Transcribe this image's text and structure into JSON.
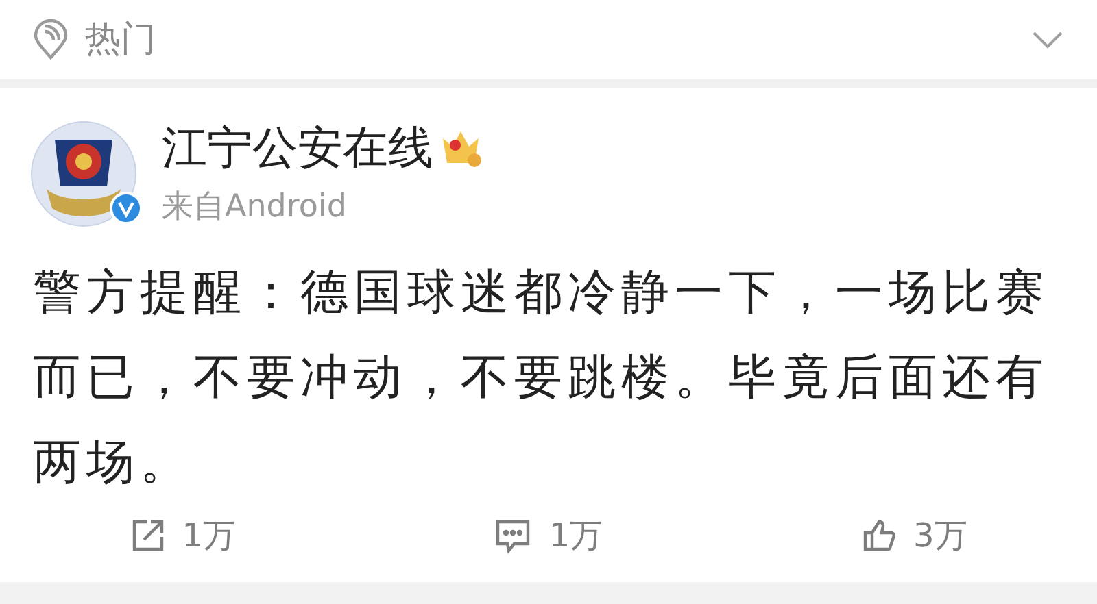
{
  "header": {
    "title": "热门"
  },
  "post": {
    "author": "江宁公安在线",
    "source": "来自Android",
    "verified": true,
    "text": "警方提醒：德国球迷都冷静一下，一场比赛而已，不要冲动，不要跳楼。毕竟后面还有两场。"
  },
  "actions": [
    {
      "kind": "repost",
      "count": "1万"
    },
    {
      "kind": "comment",
      "count": "1万"
    },
    {
      "kind": "like",
      "count": "3万"
    }
  ]
}
